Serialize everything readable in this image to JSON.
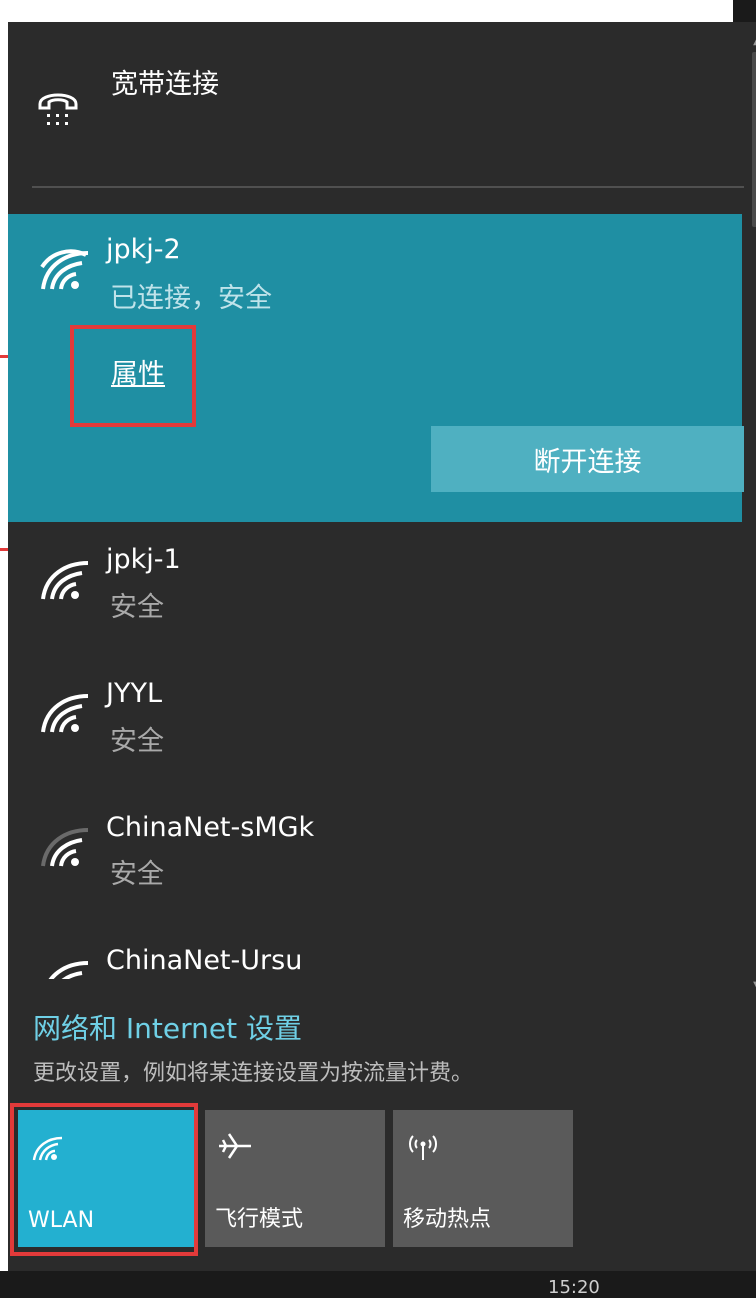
{
  "broadband": {
    "label": "宽带连接",
    "icon": "dialup-phone-icon"
  },
  "networks": {
    "selected": {
      "name": "jpkj-2",
      "status": "已连接，安全",
      "properties_link": "属性",
      "disconnect_label": "断开连接"
    },
    "items": [
      {
        "name": "jpkj-1",
        "status": "安全"
      },
      {
        "name": "JYYL",
        "status": "安全"
      },
      {
        "name": "ChinaNet-sMGk",
        "status": "安全"
      },
      {
        "name": "ChinaNet-Ursu",
        "status": ""
      }
    ]
  },
  "settings": {
    "title": "网络和 Internet 设置",
    "subtitle": "更改设置，例如将某连接设置为按流量计费。"
  },
  "quick_actions": [
    {
      "label": "WLAN",
      "icon": "wifi-icon",
      "active": true
    },
    {
      "label": "飞行模式",
      "icon": "airplane-icon",
      "active": false
    },
    {
      "label": "移动热点",
      "icon": "hotspot-icon",
      "active": false
    }
  ],
  "taskbar": {
    "time": "15:20"
  },
  "colors": {
    "accent": "#1f8fa3",
    "tile_active": "#23b0d0",
    "tile_inactive": "#5a5a5a",
    "link": "#6fd0e6",
    "highlight_box": "#e23a3a"
  }
}
